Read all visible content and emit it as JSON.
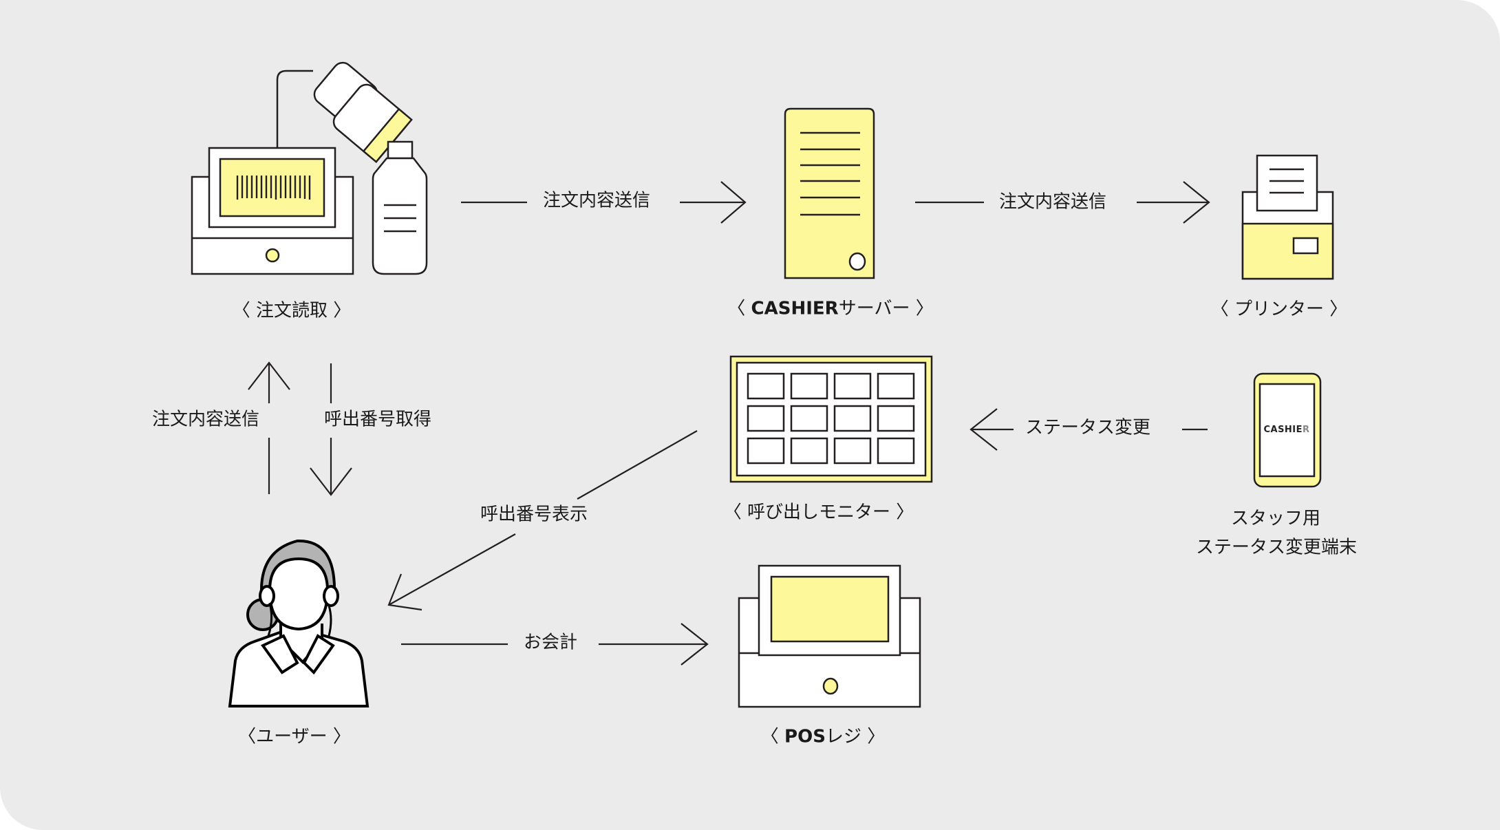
{
  "colors": {
    "background": "#ebebeb",
    "accent_yellow": "#fdf99b",
    "stroke": "#231f20",
    "hair_gray": "#b3b3b3",
    "white": "#ffffff"
  },
  "nodes": {
    "order_reader": {
      "label": "〈 注文読取 〉",
      "icon": "barcode-scanner-register-icon"
    },
    "server": {
      "label_prefix": "〈 ",
      "label_bold": "CASHIER",
      "label_suffix": "サーバー 〉",
      "icon": "server-tower-icon"
    },
    "printer": {
      "label": "〈 プリンター 〉",
      "icon": "receipt-printer-icon"
    },
    "call_monitor": {
      "label": "〈 呼び出しモニター 〉",
      "icon": "call-monitor-icon"
    },
    "staff_terminal": {
      "label_line1": "スタッフ用",
      "label_line2": "ステータス変更端末",
      "screen_text_main": "CASHIE",
      "screen_text_dim": "R",
      "icon": "smartphone-icon"
    },
    "user": {
      "label": "〈ユーザー 〉",
      "icon": "user-woman-icon"
    },
    "pos_register": {
      "label_prefix": "〈 ",
      "label_bold": "POS",
      "label_suffix": "レジ 〉",
      "icon": "pos-register-icon"
    }
  },
  "flows": {
    "reader_to_server": "注文内容送信",
    "server_to_printer": "注文内容送信",
    "terminal_to_monitor": "ステータス変更",
    "user_to_reader": "注文内容送信",
    "reader_to_user": "呼出番号取得",
    "monitor_to_user": "呼出番号表示",
    "user_to_pos": "お会計"
  }
}
